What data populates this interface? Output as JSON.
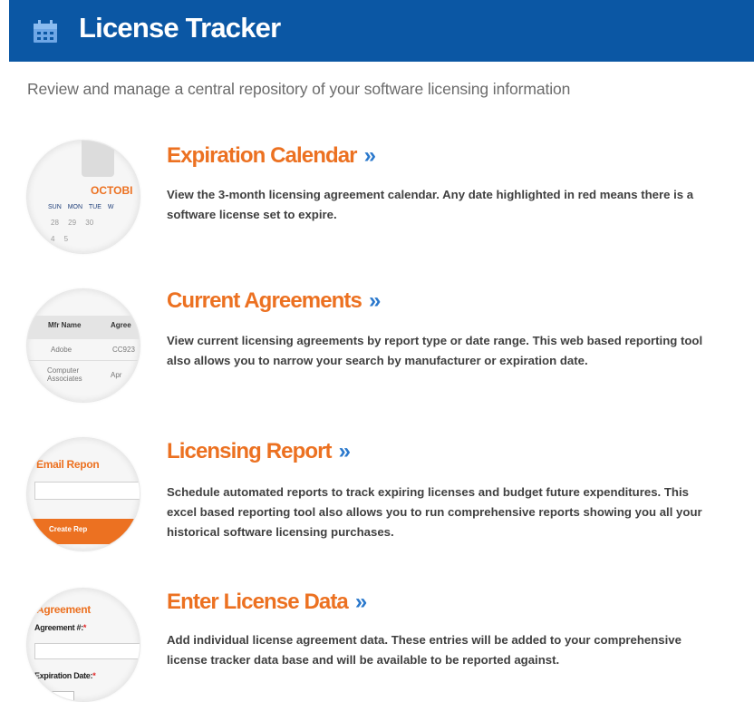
{
  "header": {
    "title": "License Tracker",
    "icon": "calendar-icon",
    "background_color": "#0b57a4"
  },
  "subtitle": "Review and manage a central repository of your software licensing information",
  "accent_color": "#ec7121",
  "link_arrow_color": "#2a78cc",
  "sections": [
    {
      "title": "Expiration Calendar",
      "arrow": "»",
      "description": "View the 3-month licensing agreement calendar. Any date highlighted in red means there is a software license set to expire.",
      "thumbnail": {
        "month": "OCTOBI",
        "weekdays": "SUN MON TUE W",
        "row1": "28 29 30",
        "row2": "4 5"
      }
    },
    {
      "title": "Current Agreements",
      "arrow": "»",
      "description": "View current licensing agreements by report type or date range. This web based reporting tool also allows you to narrow your search by manufacturer or expiration date.",
      "thumbnail": {
        "col1_header": "Mfr Name",
        "col2_header": "Agree",
        "rows": [
          {
            "c1": "Adobe",
            "c2": "CC923"
          },
          {
            "c1": "Computer Associates",
            "c2": "Apr"
          }
        ]
      }
    },
    {
      "title": "Licensing Report",
      "arrow": "»",
      "description": "Schedule automated reports to track expiring licenses and budget future expenditures. This excel based reporting tool also allows you to run comprehensive reports showing you all your historical software licensing purchases.",
      "thumbnail": {
        "title": "Email Repon",
        "button": "Create Rep"
      }
    },
    {
      "title": "Enter License Data",
      "arrow": "»",
      "description": "Add individual license agreement data. These entries will be added to your comprehensive license tracker data base and will be available to be reported against.",
      "thumbnail": {
        "title": "Agreement",
        "label1": "Agreement #:",
        "label2": "Expiration Date:",
        "required_mark": "*"
      }
    }
  ]
}
